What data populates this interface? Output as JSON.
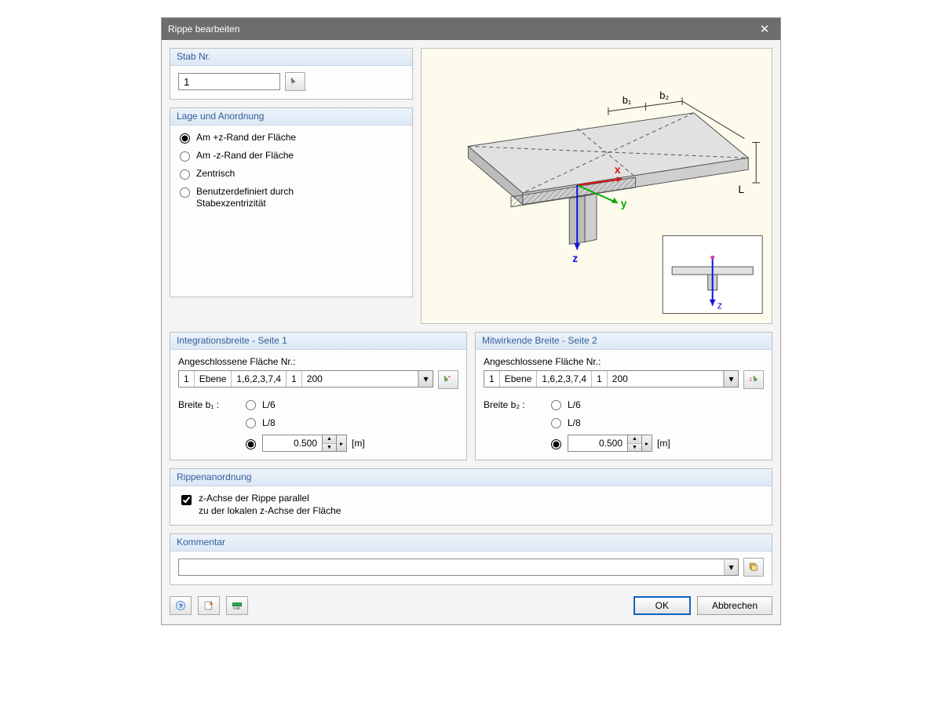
{
  "dialog": {
    "title": "Rippe bearbeiten"
  },
  "stab": {
    "group_title": "Stab Nr.",
    "value": "1"
  },
  "lage": {
    "group_title": "Lage und Anordnung",
    "opt_plus_z": "Am +z-Rand der Fläche",
    "opt_minus_z": "Am -z-Rand der Fläche",
    "opt_zentrisch": "Zentrisch",
    "opt_user_line1": "Benutzerdefiniert durch",
    "opt_user_line2": "Stabexzentrizität",
    "selected": "plus_z"
  },
  "preview": {
    "label_b1": "b₁",
    "label_b2": "b₂",
    "label_L": "L",
    "label_x": "x",
    "label_y": "y",
    "label_z": "z"
  },
  "side1": {
    "group_title": "Integrationsbreite - Seite 1",
    "conn_label": "Angeschlossene Fläche Nr.:",
    "seg1": "1",
    "seg2": "Ebene",
    "seg3": "1,6,2,3,7,4",
    "seg4": "1",
    "seg5": "200",
    "width_label": "Breite b₁ :",
    "opt_l6": "L/6",
    "opt_l8": "L/8",
    "value": "0.500",
    "unit": "[m]"
  },
  "side2": {
    "group_title": "Mitwirkende Breite - Seite 2",
    "conn_label": "Angeschlossene Fläche Nr.:",
    "seg1": "1",
    "seg2": "Ebene",
    "seg3": "1,6,2,3,7,4",
    "seg4": "1",
    "seg5": "200",
    "width_label": "Breite b₂ :",
    "opt_l6": "L/6",
    "opt_l8": "L/8",
    "value": "0.500",
    "unit": "[m]"
  },
  "arrangement": {
    "group_title": "Rippenanordnung",
    "check_line1": "z-Achse der Rippe parallel",
    "check_line2": "zu der lokalen z-Achse der Fläche",
    "checked": true
  },
  "kommentar": {
    "group_title": "Kommentar",
    "value": ""
  },
  "footer": {
    "ok": "OK",
    "cancel": "Abbrechen"
  }
}
